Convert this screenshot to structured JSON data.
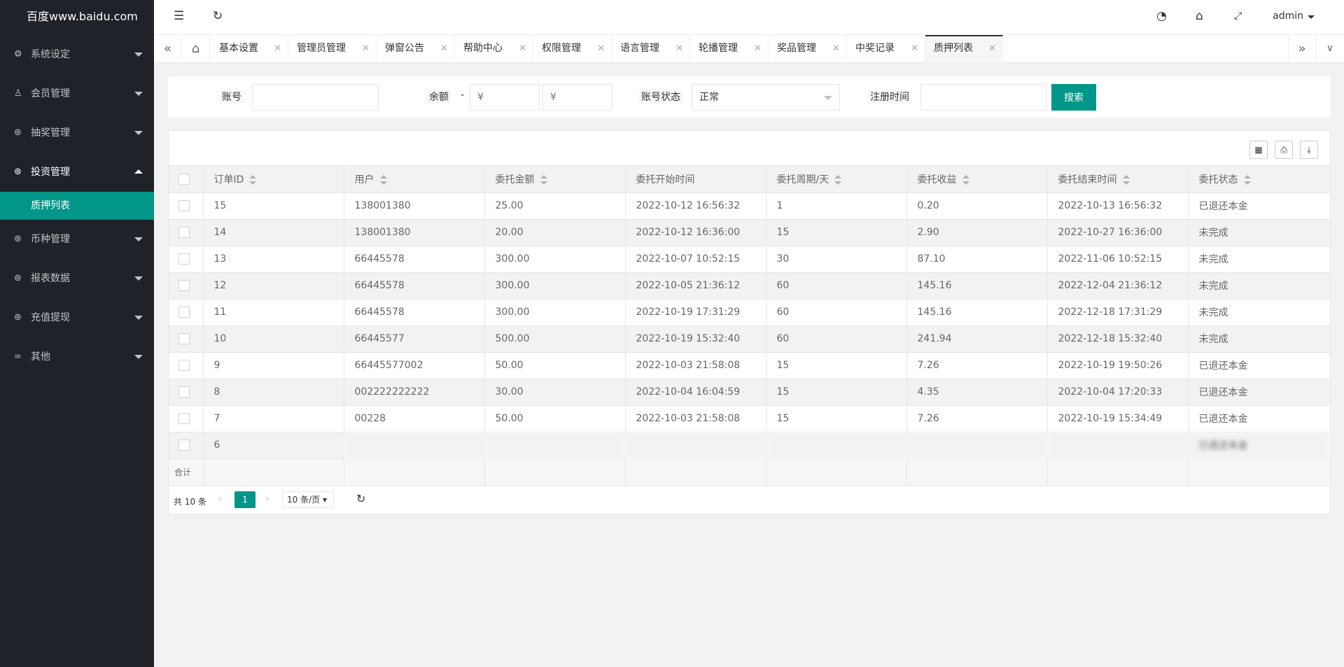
{
  "app": {
    "logo": "百度www.baidu.com"
  },
  "sidebar": {
    "items": [
      {
        "label": "系统设定",
        "icon": "gear-icon"
      },
      {
        "label": "会员管理",
        "icon": "user-icon"
      },
      {
        "label": "抽奖管理",
        "icon": "yen-icon"
      },
      {
        "label": "投资管理",
        "icon": "yen-icon"
      },
      {
        "label": "币种管理",
        "icon": "yen-icon"
      },
      {
        "label": "报表数据",
        "icon": "yen-icon"
      },
      {
        "label": "充值提现",
        "icon": "yen-icon"
      },
      {
        "label": "其他",
        "icon": "link-icon"
      }
    ],
    "active_sub": "质押列表"
  },
  "header": {
    "user": "admin"
  },
  "tabs": [
    {
      "label": "基本设置"
    },
    {
      "label": "管理员管理"
    },
    {
      "label": "弹窗公告"
    },
    {
      "label": "帮助中心"
    },
    {
      "label": "权限管理"
    },
    {
      "label": "语言管理"
    },
    {
      "label": "轮播管理"
    },
    {
      "label": "奖品管理"
    },
    {
      "label": "中奖记录"
    },
    {
      "label": "质押列表"
    }
  ],
  "search": {
    "account_label": "账号",
    "account_value": "",
    "balance_label": "余额",
    "balance_sep": "-",
    "balance_min_placeholder": "¥",
    "balance_max_placeholder": "¥",
    "status_label": "账号状态",
    "status_value": "正常",
    "regtime_label": "注册时间",
    "regtime_value": "",
    "button": "搜索"
  },
  "table": {
    "columns": [
      "订单ID",
      "用户",
      "委托金额",
      "委托开始时间",
      "委托周期/天",
      "委托收益",
      "委托结束时间",
      "委托状态"
    ],
    "rows": [
      [
        "15",
        "138001380",
        "25.00",
        "2022-10-12 16:56:32",
        "1",
        "0.20",
        "2022-10-13 16:56:32",
        "已退还本金"
      ],
      [
        "14",
        "138001380",
        "20.00",
        "2022-10-12 16:36:00",
        "15",
        "2.90",
        "2022-10-27 16:36:00",
        "未完成"
      ],
      [
        "13",
        "66445578",
        "300.00",
        "2022-10-07 10:52:15",
        "30",
        "87.10",
        "2022-11-06 10:52:15",
        "未完成"
      ],
      [
        "12",
        "66445578",
        "300.00",
        "2022-10-05 21:36:12",
        "60",
        "145.16",
        "2022-12-04 21:36:12",
        "未完成"
      ],
      [
        "11",
        "66445578",
        "300.00",
        "2022-10-19 17:31:29",
        "60",
        "145.16",
        "2022-12-18 17:31:29",
        "未完成"
      ],
      [
        "10",
        "66445577",
        "500.00",
        "2022-10-19 15:32:40",
        "60",
        "241.94",
        "2022-12-18 15:32:40",
        "未完成"
      ],
      [
        "9",
        "66445577002",
        "50.00",
        "2022-10-03 21:58:08",
        "15",
        "7.26",
        "2022-10-19 19:50:26",
        "已退还本金"
      ],
      [
        "8",
        "002222222222",
        "30.00",
        "2022-10-04 16:04:59",
        "15",
        "4.35",
        "2022-10-04 17:20:33",
        "已退还本金"
      ],
      [
        "7",
        "00228",
        "50.00",
        "2022-10-03 21:58:08",
        "15",
        "7.26",
        "2022-10-19 15:34:49",
        "已退还本金"
      ],
      [
        "6",
        "",
        "",
        "",
        "",
        "",
        "",
        "已退还本金"
      ]
    ],
    "total_label": "合计"
  },
  "pager": {
    "count": "共 10 条",
    "page": "1",
    "limit": "10 条/页"
  }
}
